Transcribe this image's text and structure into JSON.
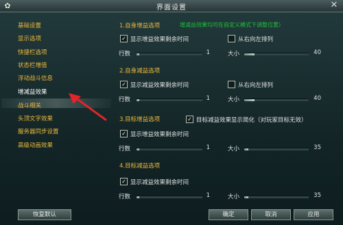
{
  "window": {
    "title": "界面设置",
    "logo_glyph": "✿",
    "close_glyph": "✕"
  },
  "sidebar": {
    "items": [
      {
        "label": "基础设置"
      },
      {
        "label": "显示选项"
      },
      {
        "label": "快捷栏选项"
      },
      {
        "label": "状态栏增值"
      },
      {
        "label": "浮动战斗信息"
      },
      {
        "label": "增减益效果",
        "selected": true
      },
      {
        "label": "战斗相关"
      },
      {
        "label": "头顶文字效果"
      },
      {
        "label": "服务器同步设置"
      },
      {
        "label": "高级动画效果"
      }
    ]
  },
  "main": {
    "hint": "增减益效果均可在自定义模式下调整位置）",
    "sections": [
      {
        "title": "1.自身增益选项",
        "show_time": {
          "label": "显示增益效果剩余时间",
          "checked": true
        },
        "right_to_left": {
          "label": "从右向左排列",
          "checked": false
        },
        "rows": {
          "label": "行数",
          "value": "1",
          "fraction": 0.0
        },
        "size": {
          "label": "大小",
          "value": "40",
          "fraction": 0.16
        }
      },
      {
        "title": "2.自身减益选项",
        "show_time": {
          "label": "显示减益效果剩余时间",
          "checked": true
        },
        "right_to_left": {
          "label": "从右向左排列",
          "checked": false
        },
        "rows": {
          "label": "行数",
          "value": "1",
          "fraction": 0.0
        },
        "size": {
          "label": "大小",
          "value": "40",
          "fraction": 0.16
        }
      },
      {
        "title": "3.目标增益选项",
        "simplify": {
          "label": "目标减益效果显示简化（对玩家目标无效）",
          "checked": true
        },
        "show_time": {
          "label": "显示增益效果剩余时间",
          "checked": true
        },
        "rows": {
          "label": "行数",
          "value": "1",
          "fraction": 0.0
        },
        "size": {
          "label": "大小",
          "value": "35",
          "fraction": 0.06
        }
      },
      {
        "title": "4.目标减益选项",
        "show_time": {
          "label": "显示减益效果剩余时间",
          "checked": true
        },
        "rows": {
          "label": "行数",
          "value": "1",
          "fraction": 0.0
        },
        "size": {
          "label": "大小",
          "value": "35",
          "fraction": 0.06
        }
      }
    ]
  },
  "footer": {
    "restore_default": "恢复默认",
    "confirm": "确定",
    "cancel": "取消",
    "apply": "应用"
  },
  "colors": {
    "accent": "#eeba3c",
    "hint": "#1fc23a",
    "arrow": "#e0252b"
  }
}
